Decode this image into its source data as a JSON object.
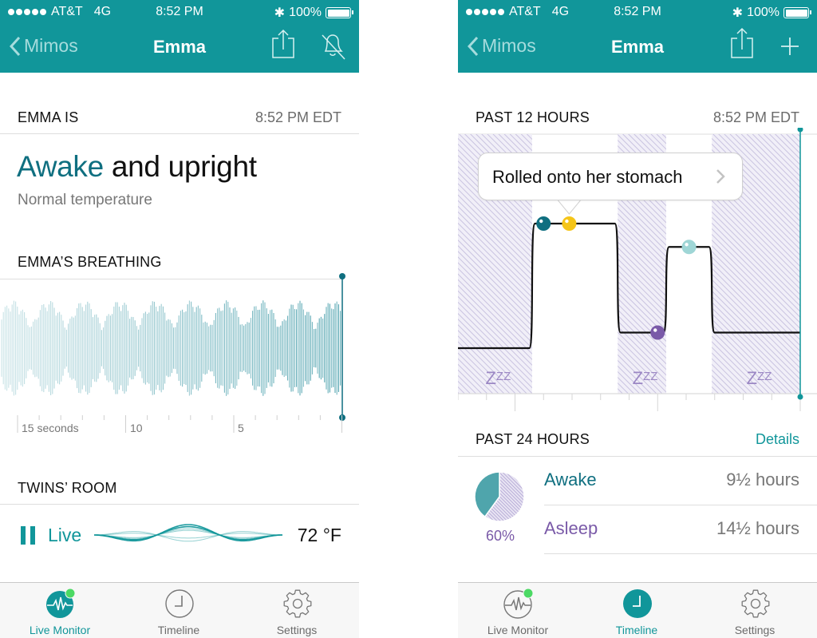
{
  "colors": {
    "teal": "#11969a",
    "dark_teal": "#0f6f80",
    "purple": "#7a5aa8",
    "yellow": "#f5c518",
    "light_teal": "#9fd6d6",
    "hatch": "#c9c3e0",
    "live_green": "#4cd964"
  },
  "status_bar": {
    "carrier": "AT&T",
    "network": "4G",
    "time": "8:52 PM",
    "battery": "100%"
  },
  "left_screen": {
    "nav": {
      "back_label": "Mimos",
      "title": "Emma",
      "icons": [
        "share-icon",
        "bell-muted-icon"
      ]
    },
    "status_section": {
      "heading": "EMMA IS",
      "time": "8:52 PM EDT",
      "state_accent": "Awake",
      "state_rest": " and upright",
      "temperature_note": "Normal temperature"
    },
    "breathing_section": {
      "heading": "EMMA’S BREATHING",
      "axis_labels": [
        "15 seconds",
        "10",
        "5"
      ]
    },
    "room_section": {
      "heading": "TWINS’ ROOM",
      "live_label": "Live",
      "temperature": "72 °F"
    }
  },
  "right_screen": {
    "nav": {
      "back_label": "Mimos",
      "title": "Emma",
      "icons": [
        "share-icon",
        "plus-icon"
      ]
    },
    "past12": {
      "heading": "PAST 12 HOURS",
      "time": "8:52 PM EDT",
      "tooltip": "Rolled onto her stomach",
      "sleep_marker": "zzz"
    },
    "past24": {
      "heading": "PAST 24 HOURS",
      "details_link": "Details",
      "percent_label": "60%",
      "rows": [
        {
          "label": "Awake",
          "value": "9½ hours"
        },
        {
          "label": "Asleep",
          "value": "14½ hours"
        }
      ]
    }
  },
  "tabbar": {
    "left_active": "Live Monitor",
    "right_active": "Timeline",
    "tabs": [
      {
        "label": "Live Monitor",
        "icon": "waveform-icon"
      },
      {
        "label": "Timeline",
        "icon": "clock-icon"
      },
      {
        "label": "Settings",
        "icon": "gear-icon"
      }
    ]
  },
  "chart_data": [
    {
      "type": "line",
      "title": "PAST 12 HOURS",
      "description": "Activity level step line over past 12 hours with asleep periods shaded",
      "x_unit": "hours ago",
      "xlim": [
        12,
        0
      ],
      "series": [
        {
          "name": "activity",
          "points": [
            [
              12,
              0.1
            ],
            [
              9.5,
              0.1
            ],
            [
              9.3,
              0.9
            ],
            [
              6.5,
              0.9
            ],
            [
              6.3,
              0.2
            ],
            [
              4.8,
              0.2
            ],
            [
              4.6,
              0.75
            ],
            [
              3.2,
              0.75
            ],
            [
              3.0,
              0.2
            ],
            [
              0,
              0.2
            ]
          ]
        }
      ],
      "asleep_periods": [
        [
          12,
          9.4
        ],
        [
          6.4,
          4.7
        ],
        [
          3.1,
          0
        ]
      ],
      "events": [
        {
          "hours_ago": 9.0,
          "level": 0.9,
          "color": "#0f6f80"
        },
        {
          "hours_ago": 8.1,
          "level": 0.9,
          "color": "#f5c518",
          "label": "Rolled onto her stomach"
        },
        {
          "hours_ago": 5.0,
          "level": 0.2,
          "color": "#7a5aa8"
        },
        {
          "hours_ago": 3.9,
          "level": 0.75,
          "color": "#9fd6d6"
        }
      ]
    },
    {
      "type": "pie",
      "title": "PAST 24 HOURS",
      "slices": [
        {
          "label": "Asleep",
          "value": 60,
          "color": "#c9c3e0"
        },
        {
          "label": "Awake",
          "value": 40,
          "color": "#4fa5ac"
        }
      ],
      "center_label": "60%"
    }
  ]
}
